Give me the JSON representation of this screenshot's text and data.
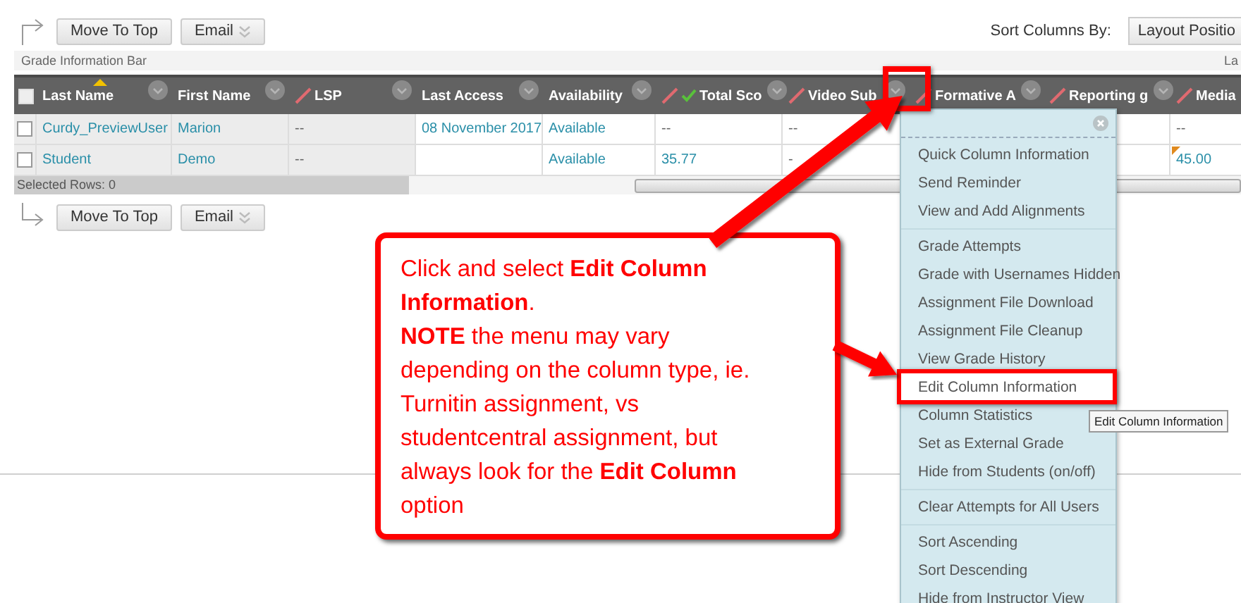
{
  "top_toolbar": {
    "buttons": [
      {
        "label": "Move To Top",
        "kind": "plain"
      },
      {
        "label": "Email",
        "kind": "dropdown"
      }
    ]
  },
  "sort": {
    "label": "Sort Columns By:",
    "value": "Layout Positio"
  },
  "info_bar": {
    "label": "Grade Information Bar",
    "right_text": "La"
  },
  "table": {
    "header_checked": false,
    "columns": [
      {
        "label": "Last Name",
        "kind": "plain",
        "sorted": true
      },
      {
        "label": "First Name",
        "kind": "plain",
        "sorted": false
      },
      {
        "label": "LSP",
        "kind": "grade",
        "sorted": false
      },
      {
        "label": "Last Access",
        "kind": "plain",
        "sorted": false
      },
      {
        "label": "Availability",
        "kind": "plain",
        "sorted": false
      },
      {
        "label": "Total Sco",
        "kind": "total",
        "sorted": false
      },
      {
        "label": "Video Sub",
        "kind": "grade",
        "sorted": false
      },
      {
        "label": "Formative A",
        "kind": "grade",
        "sorted": false
      },
      {
        "label": "Reporting g",
        "kind": "grade",
        "sorted": false
      },
      {
        "label": "Media",
        "kind": "grade",
        "sorted": false
      }
    ],
    "rows": [
      {
        "checked": false,
        "cells": [
          {
            "text": "Curdy_PreviewUser",
            "kind": "link"
          },
          {
            "text": "Marion",
            "kind": "link"
          },
          {
            "text": "--",
            "kind": "plain"
          },
          {
            "text": "08 November 2017",
            "kind": "link"
          },
          {
            "text": "Available",
            "kind": "link"
          },
          {
            "text": "--",
            "kind": "plain"
          },
          {
            "text": "--",
            "kind": "plain"
          },
          null,
          {
            "kind": "empty"
          },
          {
            "text": "--",
            "kind": "plain"
          }
        ]
      },
      {
        "checked": false,
        "cells": [
          {
            "text": "Student",
            "kind": "link"
          },
          {
            "text": "Demo",
            "kind": "link"
          },
          {
            "text": "--",
            "kind": "plain"
          },
          {
            "kind": "empty"
          },
          {
            "text": "Available",
            "kind": "link"
          },
          {
            "text": "35.77",
            "kind": "link"
          },
          {
            "text": "-",
            "kind": "plain"
          },
          null,
          {
            "kind": "empty"
          },
          {
            "text": "45.00",
            "kind": "link",
            "flagged": true
          }
        ]
      }
    ],
    "footer": "Selected Rows: 0"
  },
  "bottom_toolbar": {
    "buttons": [
      {
        "label": "Move To Top",
        "kind": "plain"
      },
      {
        "label": "Email",
        "kind": "dropdown"
      }
    ]
  },
  "callout": {
    "paragraphs": [
      "Click and select **Edit Column Information**.",
      "**NOTE** the menu may vary depending on the column type, ie. Turnitin assignment, vs studentcentral assignment, but always look for the **Edit Column** option"
    ]
  },
  "menu": {
    "groups": [
      {
        "items": [
          {
            "label": "Quick Column Information",
            "selected": false
          },
          {
            "label": "Send Reminder",
            "selected": false
          },
          {
            "label": "View and Add Alignments",
            "selected": false
          }
        ]
      },
      {
        "items": [
          {
            "label": "Grade Attempts",
            "selected": false
          },
          {
            "label": "Grade with Usernames Hidden",
            "selected": false
          },
          {
            "label": "Assignment File Download",
            "selected": false
          },
          {
            "label": "Assignment File Cleanup",
            "selected": false
          },
          {
            "label": "View Grade History",
            "selected": false
          },
          {
            "label": "Edit Column Information",
            "selected": true
          },
          {
            "label": "Column Statistics",
            "selected": false
          },
          {
            "label": "Set as External Grade",
            "selected": false
          },
          {
            "label": "Hide from Students (on/off)",
            "selected": false
          }
        ]
      },
      {
        "items": [
          {
            "label": "Clear Attempts for All Users",
            "selected": false
          }
        ]
      },
      {
        "items": [
          {
            "label": "Sort Ascending",
            "selected": false
          },
          {
            "label": "Sort Descending",
            "selected": false
          },
          {
            "label": "Hide from Instructor View",
            "selected": false
          }
        ]
      }
    ]
  },
  "tooltip": "Edit Column Information"
}
